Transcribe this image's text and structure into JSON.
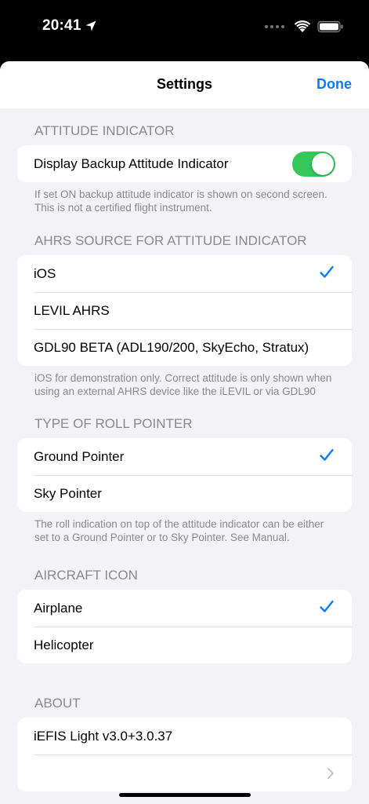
{
  "status_bar": {
    "time": "20:41"
  },
  "nav": {
    "title": "Settings",
    "done_label": "Done"
  },
  "sections": {
    "attitude": {
      "header": "ATTITUDE INDICATOR",
      "row_label": "Display Backup Attitude Indicator",
      "toggle_on": true,
      "footer": "If set ON backup attitude indicator is shown on second screen. This is not a certified flight instrument."
    },
    "ahrs": {
      "header": "AHRS SOURCE FOR ATTITUDE INDICATOR",
      "options": [
        "iOS",
        "LEVIL AHRS",
        "GDL90 BETA (ADL190/200, SkyEcho, Stratux)"
      ],
      "selected": "iOS",
      "footer": "iOS for demonstration only. Correct attitude is only shown when using an external AHRS device like the iLEVIL or via GDL90"
    },
    "roll": {
      "header": "TYPE OF ROLL POINTER",
      "options": [
        "Ground Pointer",
        "Sky Pointer"
      ],
      "selected": "Ground Pointer",
      "footer": "The roll indication on top of the attitude indicator can be either set to a Ground Pointer or to Sky Pointer. See Manual."
    },
    "aircraft": {
      "header": "AIRCRAFT ICON",
      "options": [
        "Airplane",
        "Helicopter"
      ],
      "selected": "Airplane"
    },
    "about": {
      "header": "ABOUT",
      "version": "iEFIS Light v3.0+3.0.37"
    }
  },
  "colors": {
    "accent": "#0a7aff",
    "toggle_on": "#34c759",
    "background": "#f2f2f7"
  }
}
